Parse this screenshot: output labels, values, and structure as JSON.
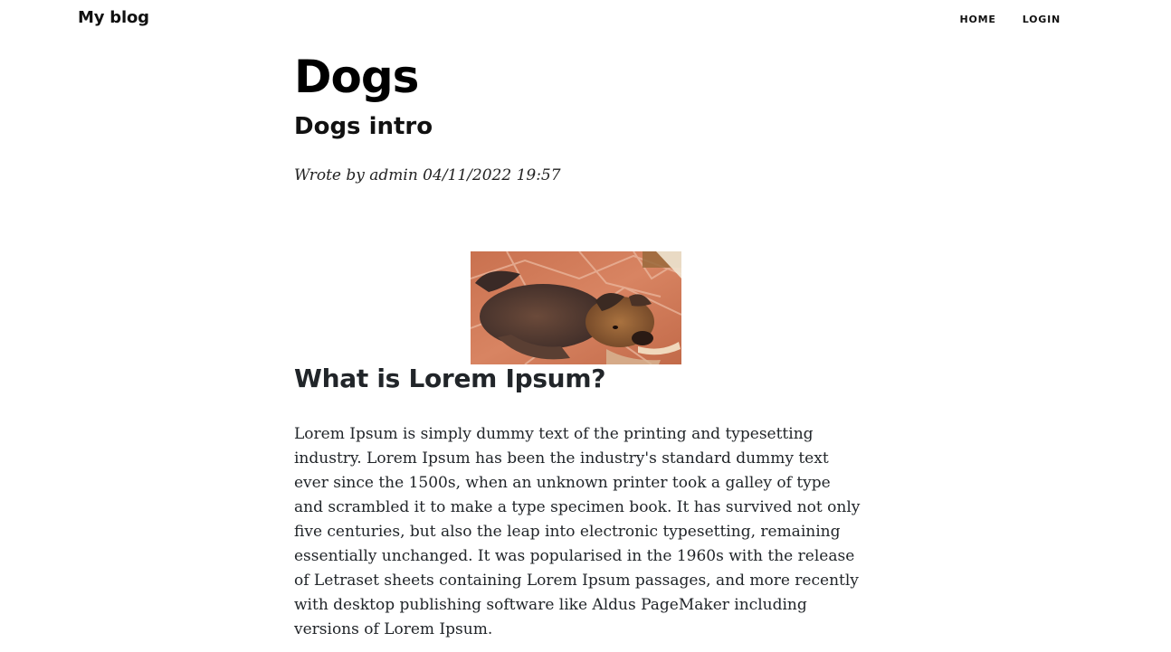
{
  "nav": {
    "brand": "My blog",
    "links": [
      "HOME",
      "LOGIN"
    ]
  },
  "post": {
    "title": "Dogs",
    "subtitle": "Dogs intro",
    "meta": "Wrote by admin 04/11/2022 19:57",
    "section_heading": "What is Lorem Ipsum?",
    "body": "Lorem Ipsum is simply dummy text of the printing and typesetting industry. Lorem Ipsum has been the industry's standard dummy text ever since the 1500s, when an unknown printer took a galley of type and scrambled it to make a type specimen book. It has survived not only five centuries, but also the leap into electronic typesetting, remaining essentially unchanged. It was popularised in the 1960s with the release of Letraset sheets containing Lorem Ipsum passages, and more recently with desktop publishing software like Aldus PageMaker including versions of Lorem Ipsum."
  }
}
